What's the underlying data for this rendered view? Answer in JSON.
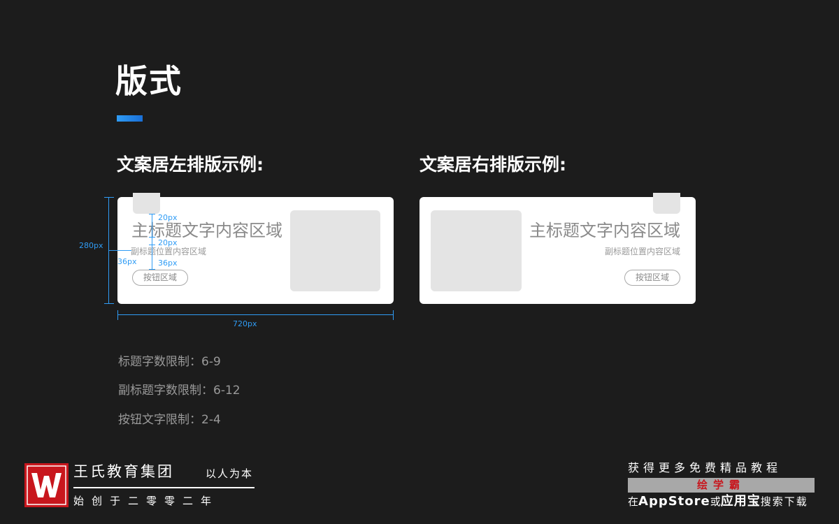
{
  "page": {
    "title": "版式",
    "accent_color": "#2f9cf5",
    "background_color": "#1c1c1c"
  },
  "left_example": {
    "section_title": "文案居左排版示例:",
    "card_title": "主标题文字内容区域",
    "card_subtitle": "副标题位置内容区域",
    "card_button": "按钮区域",
    "dimensions": {
      "height_label": "280px",
      "width_label": "720px",
      "gap1_label": "20px",
      "gap2_label": "20px",
      "gap3_label": "36px",
      "margin_label": "36px"
    }
  },
  "right_example": {
    "section_title": "文案居右排版示例:",
    "card_title": "主标题文字内容区域",
    "card_subtitle": "副标题位置内容区域",
    "card_button": "按钮区域"
  },
  "limits": [
    "标题字数限制：6-9",
    "副标题字数限制：6-12",
    "按钮文字限制：2-4"
  ],
  "footer": {
    "logo_letter": "W",
    "brand_name": "王氏教育集团",
    "motto": "以人为本",
    "founded": "始创于二零零二年",
    "promo_text": "获得更多免费精品教程",
    "promo_app": "绘学霸",
    "store_prefix": "在",
    "store_appstore": "AppStore",
    "store_or": "或",
    "store_yyb": "应用宝",
    "store_suffix": "搜索下载",
    "logo_color": "#c8161d"
  }
}
